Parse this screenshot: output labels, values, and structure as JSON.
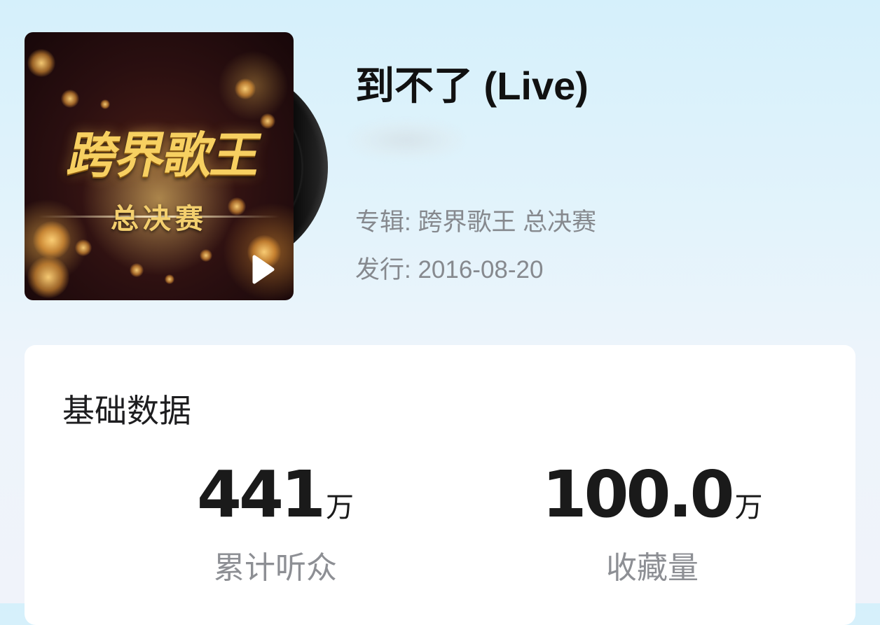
{
  "song": {
    "title": "到不了 (Live)",
    "album_line": "专辑: 跨界歌王 总决赛",
    "release_line": "发行: 2016-08-20"
  },
  "cover": {
    "title_text": "跨界歌王",
    "subtitle_text": "总决赛",
    "play_icon": "play-icon",
    "accent_gold": "#f7d061"
  },
  "stats_card": {
    "title": "基础数据",
    "stats": [
      {
        "value": "441",
        "unit": "万",
        "label": "累计听众"
      },
      {
        "value": "100.0",
        "unit": "万",
        "label": "收藏量"
      }
    ]
  }
}
